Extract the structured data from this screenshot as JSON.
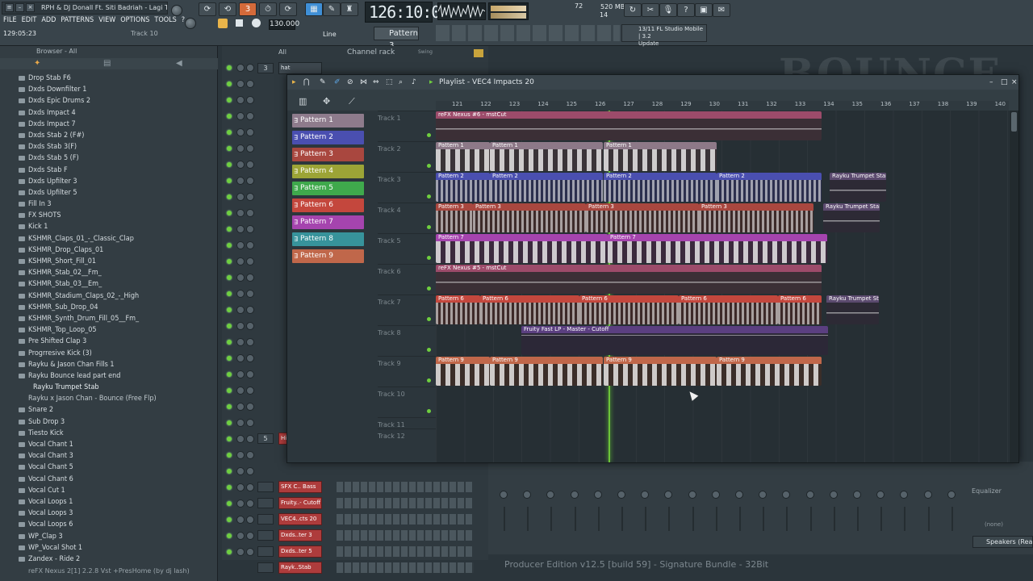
{
  "window_title": "RPH & DJ Donall Ft. Siti Badriah - Lagi Tam...",
  "menu": [
    "FILE",
    "EDIT",
    "ADD",
    "PATTERNS",
    "VIEW",
    "OPTIONS",
    "TOOLS",
    "?"
  ],
  "hint_time": "129:05:23",
  "hint_track": "Track 10",
  "bpm": "130.000",
  "song_time": "126:10:04",
  "ram_value": "72",
  "ram_mb": "520 MB",
  "ram_polyphony": "14",
  "snap_mode": "Line",
  "current_pattern": "Pattern 3",
  "news": {
    "counter": "13/11",
    "title": "FL Studio Mobile | 3.2",
    "action": "Update"
  },
  "browser": {
    "title": "Browser - All",
    "items": [
      {
        "label": "Drop Stab F6",
        "type": "folder"
      },
      {
        "label": "Dxds Downfilter 1",
        "type": "folder"
      },
      {
        "label": "Dxds Epic Drums 2",
        "type": "folder"
      },
      {
        "label": "Dxds Impact 4",
        "type": "folder"
      },
      {
        "label": "Dxds Impact 7",
        "type": "folder"
      },
      {
        "label": "Dxds Stab 2 (F#)",
        "type": "folder"
      },
      {
        "label": "Dxds Stab 3(F)",
        "type": "folder"
      },
      {
        "label": "Dxds Stab 5 (F)",
        "type": "folder"
      },
      {
        "label": "Dxds Stab F",
        "type": "folder"
      },
      {
        "label": "Dxds Upfilter 3",
        "type": "folder"
      },
      {
        "label": "Dxds Upfilter 5",
        "type": "folder"
      },
      {
        "label": "Fill In 3",
        "type": "folder"
      },
      {
        "label": "FX SHOTS",
        "type": "folder"
      },
      {
        "label": "Kick 1",
        "type": "folder"
      },
      {
        "label": "KSHMR_Claps_01_-_Classic_Clap",
        "type": "folder"
      },
      {
        "label": "KSHMR_Drop_Claps_01",
        "type": "folder"
      },
      {
        "label": "KSHMR_Short_Fill_01",
        "type": "folder"
      },
      {
        "label": "KSHMR_Stab_02__Fm_",
        "type": "folder"
      },
      {
        "label": "KSHMR_Stab_03__Em_",
        "type": "folder"
      },
      {
        "label": "KSHMR_Stadium_Claps_02_-_High",
        "type": "folder"
      },
      {
        "label": "KSHMR_Sub_Drop_04",
        "type": "folder"
      },
      {
        "label": "KSHMR_Synth_Drum_Fill_05__Fm_",
        "type": "folder"
      },
      {
        "label": "KSHMR_Top_Loop_05",
        "type": "folder"
      },
      {
        "label": "Pre Shifted Clap 3",
        "type": "folder"
      },
      {
        "label": "Progrresive Kick (3)",
        "type": "folder"
      },
      {
        "label": "Rayku & Jason Chan Fills 1",
        "type": "folder"
      },
      {
        "label": "Rayku Bounce lead part end",
        "type": "folder"
      },
      {
        "label": "Rayku Trumpet Stab",
        "type": "child"
      },
      {
        "label": "Rayku x Jason Chan - Bounce (Free Flp)",
        "type": "plain"
      },
      {
        "label": "Snare 2",
        "type": "folder"
      },
      {
        "label": "Sub Drop 3",
        "type": "folder"
      },
      {
        "label": "Tiesto Kick",
        "type": "folder"
      },
      {
        "label": "Vocal Chant 1",
        "type": "folder"
      },
      {
        "label": "Vocal Chant 3",
        "type": "folder"
      },
      {
        "label": "Vocal Chant 5",
        "type": "folder"
      },
      {
        "label": "Vocal Chant 6",
        "type": "folder"
      },
      {
        "label": "Vocal Cut 1",
        "type": "folder"
      },
      {
        "label": "Vocal Loops 1",
        "type": "folder"
      },
      {
        "label": "Vocal Loops 3",
        "type": "folder"
      },
      {
        "label": "Vocal Loops 6",
        "type": "folder"
      },
      {
        "label": "WP_Clap 3",
        "type": "folder"
      },
      {
        "label": "WP_Vocal Shot 1",
        "type": "folder"
      },
      {
        "label": "Zandex - Ride 2",
        "type": "folder"
      }
    ]
  },
  "channel_rack": {
    "title": "Channel rack",
    "filter": "All",
    "swing": "Swing",
    "rows": [
      {
        "num": "3",
        "name": "hat",
        "dark": true
      },
      {
        "num": "5",
        "name": "Hi",
        "dark": false
      },
      {
        "num": "",
        "name": "SFX C.. Bass",
        "dark": false
      },
      {
        "num": "",
        "name": "Fruity..- Cutoff",
        "dark": false
      },
      {
        "num": "",
        "name": "VEC4..cts 20",
        "dark": false
      },
      {
        "num": "",
        "name": "Dxds..ter 3",
        "dark": false
      },
      {
        "num": "",
        "name": "Dxds..ter 5",
        "dark": false
      },
      {
        "num": "",
        "name": "Rayk..Stab",
        "dark": false
      }
    ]
  },
  "playlist": {
    "title": "Playlist - VEC4 Impacts 20",
    "ruler": [
      "121",
      "122",
      "123",
      "124",
      "125",
      "126",
      "127",
      "128",
      "129",
      "130",
      "131",
      "132",
      "133",
      "134",
      "135",
      "136",
      "137",
      "138",
      "139",
      "140"
    ],
    "patterns": [
      {
        "label": "Pattern 1",
        "color": "#8e7b8c"
      },
      {
        "label": "Pattern 2",
        "color": "#4a4fb0"
      },
      {
        "label": "Pattern 3",
        "color": "#a9473f"
      },
      {
        "label": "Pattern 4",
        "color": "#9ca436"
      },
      {
        "label": "Pattern 5",
        "color": "#3fa94c"
      },
      {
        "label": "Pattern 6",
        "color": "#c4473d"
      },
      {
        "label": "Pattern 7",
        "color": "#a544ae"
      },
      {
        "label": "Pattern 8",
        "color": "#37939b"
      },
      {
        "label": "Pattern 9",
        "color": "#c0674a"
      }
    ],
    "tracks": [
      "Track 1",
      "Track 2",
      "Track 3",
      "Track 4",
      "Track 5",
      "Track 6",
      "Track 7",
      "Track 8",
      "Track 9",
      "Track 10",
      "Track 11",
      "Track 12"
    ],
    "clips": {
      "nexus6": "reFX Nexus #6 - mstCut",
      "nexus5": "reFX Nexus #5 - mstCut",
      "pattern1": "Pattern 1",
      "pattern2": "Pattern 2",
      "pattern3": "Pattern 3",
      "pattern6": "Pattern 6",
      "pattern7": "Pattern 7",
      "pattern9": "Pattern 9",
      "fruity": "Fruity Fast LP - Master - Cutoff",
      "trumpet": "Rayku Trumpet Stab"
    }
  },
  "mixer": {
    "equalizer": "Equalizer",
    "none": "(none)",
    "output": "Speakers (Realtek)"
  },
  "status": "Producer Edition v12.5 [build 59] - Signature Bundle - 32Bit",
  "bottom_text": "reFX Nexus 2[1] 2.2.8 Vst +PresHome (by dj lash)",
  "watermark": "BOUNCE"
}
